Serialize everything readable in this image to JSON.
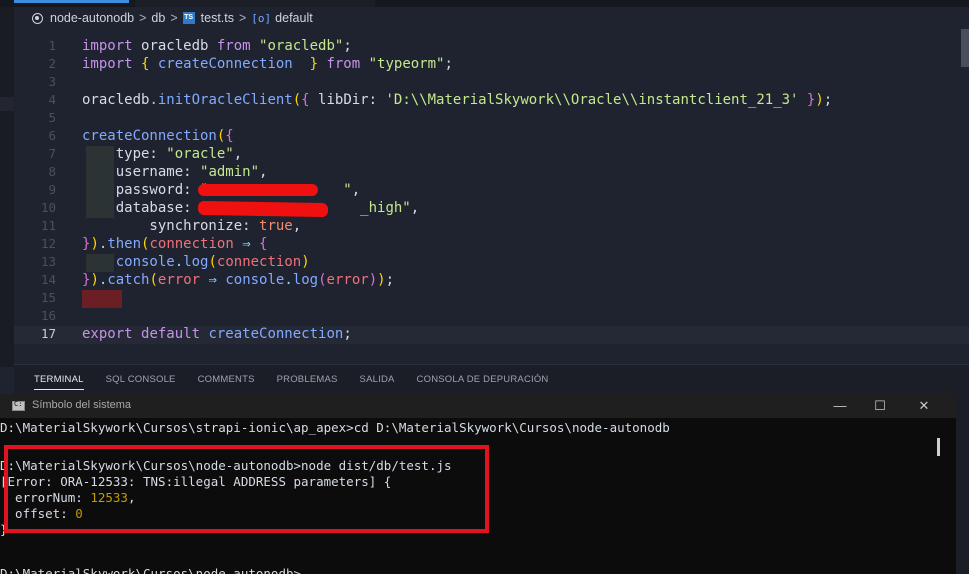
{
  "breadcrumb": {
    "items": [
      "node-autonodb",
      "db",
      "test.ts",
      "default"
    ],
    "separator": ">",
    "file_icon": "TS",
    "symbol_icon": "[o]"
  },
  "editor": {
    "active_line": 17,
    "line_numbers": [
      "1",
      "2",
      "3",
      "4",
      "5",
      "6",
      "7",
      "8",
      "9",
      "10",
      "11",
      "12",
      "13",
      "14",
      "15",
      "16",
      "17"
    ],
    "lines": [
      [
        [
          "k",
          "import "
        ],
        [
          "c",
          "oracledb "
        ],
        [
          "k",
          "from "
        ],
        [
          "s",
          "\"oracledb\""
        ],
        [
          "c",
          ";"
        ]
      ],
      [
        [
          "k",
          "import "
        ],
        [
          "p",
          "{ "
        ],
        [
          "f",
          "createConnection  "
        ],
        [
          "p",
          "} "
        ],
        [
          "k",
          "from "
        ],
        [
          "s",
          "\"typeorm\""
        ],
        [
          "c",
          ";"
        ]
      ],
      [],
      [
        [
          "c",
          "oracledb"
        ],
        [
          "ar",
          "."
        ],
        [
          "f",
          "initOracleClient"
        ],
        [
          "p",
          "("
        ],
        [
          "pr",
          "{ "
        ],
        [
          "c",
          "libDir: "
        ],
        [
          "s",
          "'D:\\\\MaterialSkywork\\\\Oracle\\\\instantclient_21_3'"
        ],
        [
          "pr",
          " }"
        ],
        [
          "p",
          ")"
        ],
        [
          "c",
          ";"
        ]
      ],
      [],
      [
        [
          "f",
          "createConnection"
        ],
        [
          "p",
          "("
        ],
        [
          "pr",
          "{"
        ]
      ],
      [
        [
          "c",
          "    type: "
        ],
        [
          "s",
          "\"oracle\""
        ],
        [
          "c",
          ","
        ]
      ],
      [
        [
          "c",
          "    username: "
        ],
        [
          "s",
          "\"admin\""
        ],
        [
          "c",
          ","
        ]
      ],
      [
        [
          "c",
          "    password: "
        ],
        [
          "s",
          "\"                \""
        ],
        [
          "c",
          ","
        ]
      ],
      [
        [
          "c",
          "    database: "
        ],
        [
          "s",
          "\"                  _high\""
        ],
        [
          "c",
          ","
        ]
      ],
      [
        [
          "c",
          "        synchronize: "
        ],
        [
          "b",
          "true"
        ],
        [
          "c",
          ","
        ]
      ],
      [
        [
          "pr",
          "}"
        ],
        [
          "p",
          ")"
        ],
        [
          "ar",
          "."
        ],
        [
          "f",
          "then"
        ],
        [
          "p",
          "("
        ],
        [
          "v",
          "connection "
        ],
        [
          "ar",
          "⇒ "
        ],
        [
          "pr",
          "{"
        ]
      ],
      [
        [
          "c",
          "    "
        ],
        [
          "f",
          "console"
        ],
        [
          "ar",
          "."
        ],
        [
          "f",
          "log"
        ],
        [
          "p",
          "("
        ],
        [
          "v",
          "connection"
        ],
        [
          "p",
          ")"
        ]
      ],
      [
        [
          "pr",
          "}"
        ],
        [
          "p",
          ")"
        ],
        [
          "ar",
          "."
        ],
        [
          "f",
          "catch"
        ],
        [
          "p",
          "("
        ],
        [
          "v",
          "error "
        ],
        [
          "ar",
          "⇒ "
        ],
        [
          "f",
          "console"
        ],
        [
          "ar",
          "."
        ],
        [
          "f",
          "log"
        ],
        [
          "pr",
          "("
        ],
        [
          "v",
          "error"
        ],
        [
          "pr",
          ")"
        ],
        [
          "p",
          ")"
        ],
        [
          "c",
          ";"
        ]
      ],
      [],
      [],
      [
        [
          "k",
          "export "
        ],
        [
          "k",
          "default "
        ],
        [
          "f",
          "createConnection"
        ],
        [
          "c",
          ";"
        ]
      ]
    ]
  },
  "panel": {
    "tabs": [
      "TERMINAL",
      "SQL CONSOLE",
      "COMMENTS",
      "PROBLEMAS",
      "SALIDA",
      "CONSOLA DE DEPURACIÓN"
    ],
    "active_tab": "TERMINAL"
  },
  "cmd": {
    "title": "Símbolo del sistema",
    "buttons": {
      "minimize": "—",
      "maximize": "☐",
      "close": "✕"
    },
    "lines": [
      [
        [
          "c",
          "D:\\MaterialSkywork\\Cursos\\strapi-ionic\\ap_apex>cd D:\\MaterialSkywork\\Cursos\\node-autonodb"
        ]
      ],
      [],
      [
        [
          "c",
          "D:\\MaterialSkywork\\Cursos\\node-autonodb>node dist/db/test.js"
        ]
      ],
      [
        [
          "c",
          "[Error: ORA-12533: TNS:illegal ADDRESS parameters] {"
        ]
      ],
      [
        [
          "c",
          "  errorNum: "
        ],
        [
          "y",
          "12533"
        ],
        [
          "c",
          ","
        ]
      ],
      [
        [
          "c",
          "  offset: "
        ],
        [
          "y",
          "0"
        ]
      ],
      [
        [
          "c",
          "}"
        ]
      ],
      [],
      [
        [
          "c",
          "D:\\MaterialSkywork\\Cursos\\node-autonodb>"
        ]
      ]
    ]
  },
  "colors": {
    "editor_bg": "#1f2330",
    "accent": "#3c8fde",
    "highlight_box": "#e0141e",
    "redaction": "#f01010"
  }
}
